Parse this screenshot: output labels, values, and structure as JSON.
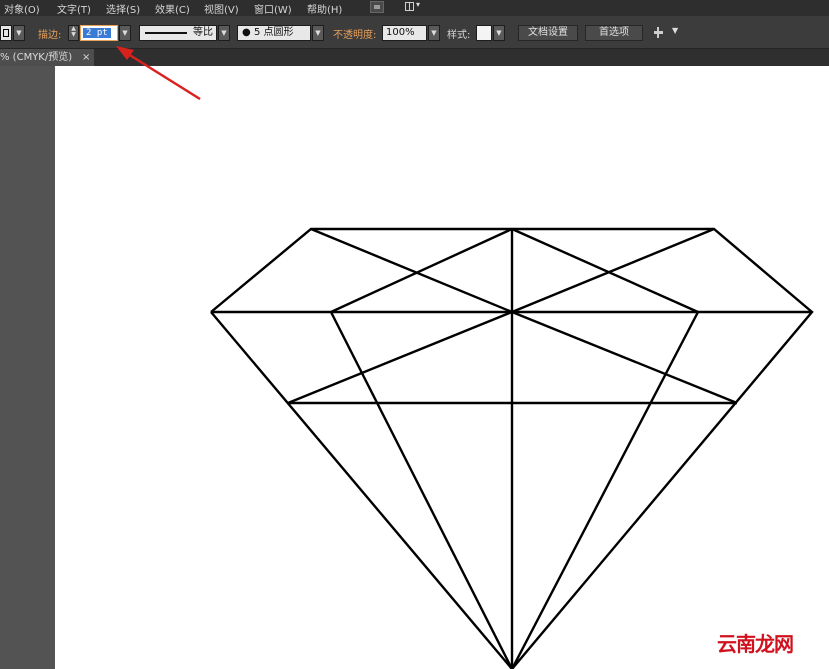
{
  "menubar": {
    "items": [
      "对象(O)",
      "文字(T)",
      "选择(S)",
      "效果(C)",
      "视图(V)",
      "窗口(W)",
      "帮助(H)"
    ],
    "icons": [
      "bridge-icon",
      "arrange-documents-icon"
    ]
  },
  "controlbar": {
    "stroke_label": "描边:",
    "stroke_weight": "2 pt",
    "profile_label": "等比",
    "brush_label": "5 点圆形",
    "opacity_label": "不透明度:",
    "opacity_value": "100%",
    "style_label": "样式:",
    "doc_setup_button": "文档设置",
    "preferences_button": "首选项"
  },
  "document_tab": {
    "title": "% (CMYK/预览)",
    "close": "×"
  },
  "annotation": {
    "arrow_color": "#d9211e"
  },
  "artwork": {
    "description_icon": "diamond-wireframe",
    "stroke_color": "#000000"
  },
  "watermark": "云南龙网",
  "colors": {
    "label_orange": "#e8a05a",
    "menubar_bg": "#2e2e2e",
    "controlbar_bg": "#3c3c3c",
    "workspace_bg": "#535353",
    "selected_value_bg": "#3a7bd5"
  }
}
